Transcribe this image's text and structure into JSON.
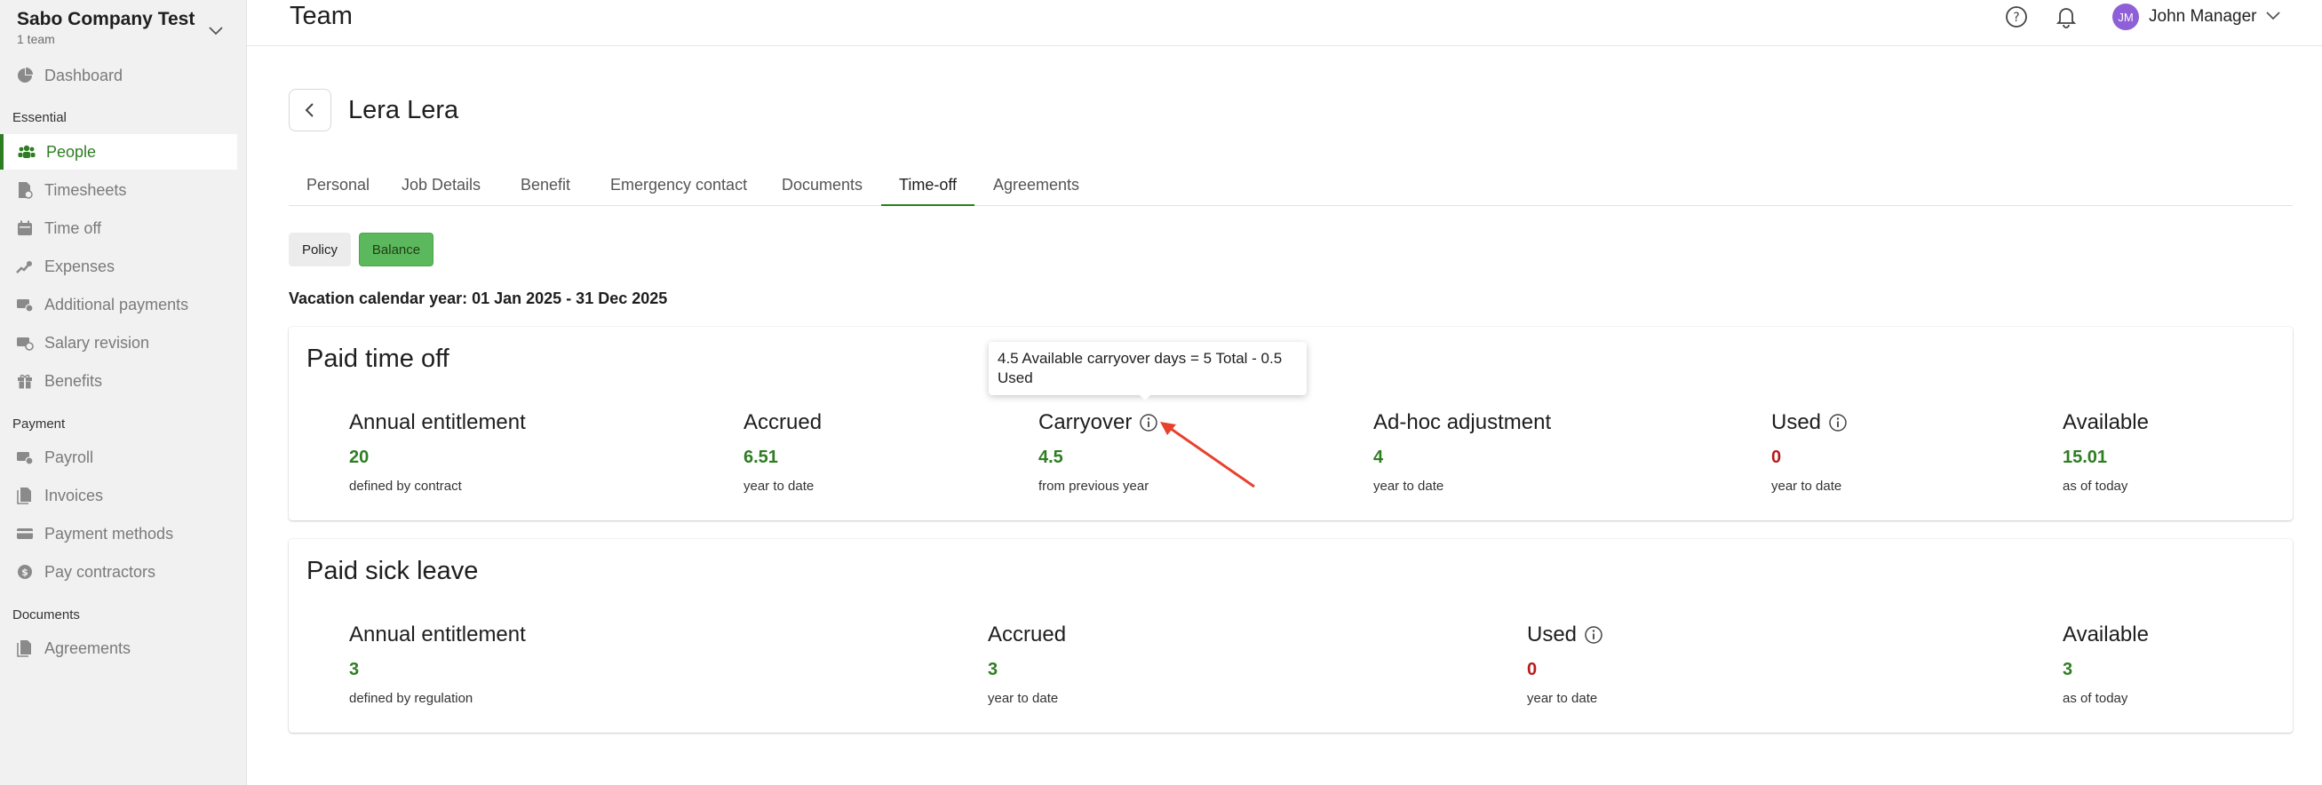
{
  "sidebar": {
    "company_name": "Sabo Company Test",
    "company_sub": "1 team",
    "items": [
      {
        "label": "Dashboard"
      },
      {
        "label": "People"
      },
      {
        "label": "Timesheets"
      },
      {
        "label": "Time off"
      },
      {
        "label": "Expenses"
      },
      {
        "label": "Additional payments"
      },
      {
        "label": "Salary revision"
      },
      {
        "label": "Benefits"
      },
      {
        "label": "Payroll"
      },
      {
        "label": "Invoices"
      },
      {
        "label": "Payment methods"
      },
      {
        "label": "Pay contractors"
      },
      {
        "label": "Agreements"
      }
    ],
    "sections": [
      "Essential",
      "Payment",
      "Documents"
    ],
    "active_item": "People"
  },
  "header": {
    "title": "Team",
    "user_initials": "JM",
    "user_name": "John Manager"
  },
  "person": {
    "name": "Lera Lera"
  },
  "tabs": [
    {
      "label": "Personal"
    },
    {
      "label": "Job Details"
    },
    {
      "label": "Benefit"
    },
    {
      "label": "Emergency contact"
    },
    {
      "label": "Documents"
    },
    {
      "label": "Time-off"
    },
    {
      "label": "Agreements"
    }
  ],
  "active_tab": "Time-off",
  "toggle": {
    "policy_label": "Policy",
    "balance_label": "Balance",
    "selected": "Balance"
  },
  "vacation_year": "Vacation calendar year: 01 Jan 2025 - 31 Dec 2025",
  "paid_time_off": {
    "title": "Paid time off",
    "stats": [
      {
        "label": "Annual entitlement",
        "value": "20",
        "sub": "defined by contract"
      },
      {
        "label": "Accrued",
        "value": "6.51",
        "sub": "year to date"
      },
      {
        "label": "Carryover",
        "value": "4.5",
        "sub": "from previous year"
      },
      {
        "label": "Ad-hoc adjustment",
        "value": "4",
        "sub": "year to date"
      },
      {
        "label": "Used",
        "value": "0",
        "sub": "year to date"
      },
      {
        "label": "Available",
        "value": "15.01",
        "sub": "as of today"
      }
    ]
  },
  "paid_sick_leave": {
    "title": "Paid sick leave",
    "stats": [
      {
        "label": "Annual entitlement",
        "value": "3",
        "sub": "defined by regulation"
      },
      {
        "label": "Accrued",
        "value": "3",
        "sub": "year to date"
      },
      {
        "label": "Used",
        "value": "0",
        "sub": "year to date"
      },
      {
        "label": "Available",
        "value": "3",
        "sub": "as of today"
      }
    ]
  },
  "tooltip": {
    "text": "4.5 Available carryover days = 5 Total - 0.5 Used"
  },
  "colors": {
    "accent_green": "#2e7d22",
    "button_green": "#5cb85c",
    "used_red": "#b71c1c",
    "avatar_purple": "#8e5fd6",
    "annotation_arrow": "#e8412c"
  }
}
